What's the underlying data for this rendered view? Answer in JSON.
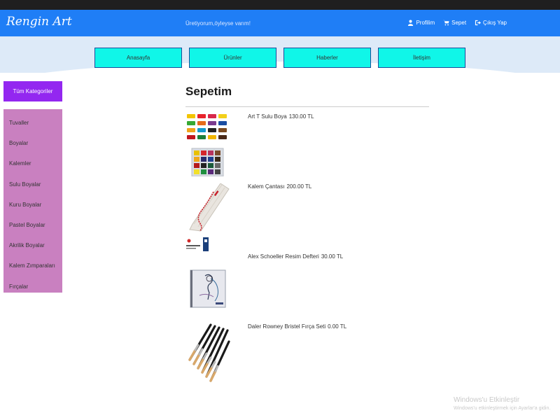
{
  "navbar": {
    "brand": "Rengin Art",
    "slogan": "Üretiyorum,öyleyse varım!",
    "links": [
      {
        "label": "Profilim",
        "icon": "user-icon"
      },
      {
        "label": "Sepet",
        "icon": "cart-icon"
      },
      {
        "label": "Çıkış Yap",
        "icon": "logout-icon"
      }
    ]
  },
  "menu": [
    "Anasayfa",
    "Ürünler",
    "Haberler",
    "İletişim"
  ],
  "sidebar": {
    "header": "Tüm Kategoriler",
    "items": [
      "Tuvaller",
      "Boyalar",
      "Kalemler",
      "Sulu Boyalar",
      "Kuru Boyalar",
      "Pastel Boyalar",
      "Akrilik Boyalar",
      "Kalem Zımparaları",
      "Fırçalar"
    ]
  },
  "cart": {
    "title": "Sepetim",
    "items": [
      {
        "name": "Art T Sulu Boya",
        "price": "130.00 TL"
      },
      {
        "name": "Kalem Çantası",
        "price": "200.00 TL"
      },
      {
        "name": "Alex Schoeller Resim Defteri",
        "price": "30.00 TL"
      },
      {
        "name": "Daler Rowney Bristel Fırça Seti",
        "price": "0.00 TL"
      }
    ]
  },
  "watermark": {
    "line1": "Windows'u Etkinleştir",
    "line2": "Windows'u etkinleştirmek için Ayarlar'a gidin."
  },
  "colors": {
    "navbar": "#1f7ef6",
    "menu_button": "#10f6e8",
    "sidebar_header": "#9327f0",
    "sidebar_list": "#c980c0"
  }
}
